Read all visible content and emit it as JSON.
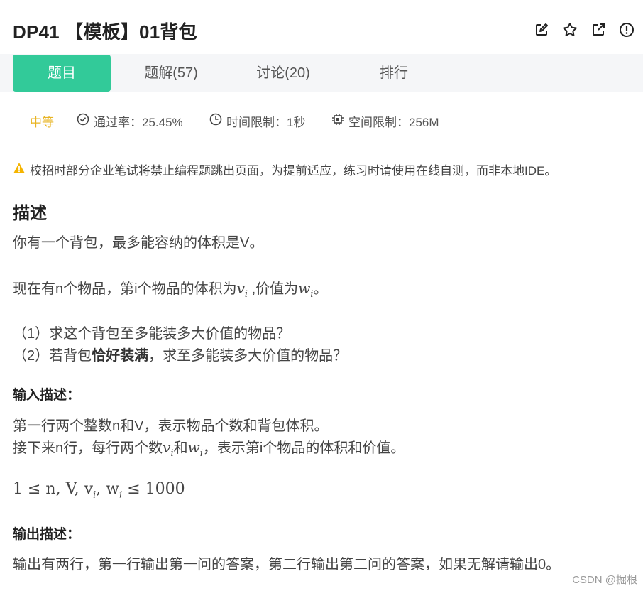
{
  "header": {
    "title": "DP41 【模板】01背包"
  },
  "tabs": [
    {
      "label": "题目"
    },
    {
      "label": "题解(57)"
    },
    {
      "label": "讨论(20)"
    },
    {
      "label": "排行"
    }
  ],
  "meta": {
    "difficulty": "中等",
    "pass_rate": "通过率：25.45%",
    "time_limit": "时间限制：1秒",
    "space_limit": "空间限制：256M"
  },
  "notice": "校招时部分企业笔试将禁止编程题跳出页面，为提前适应，练习时请使用在线自测，而非本地IDE。",
  "description": {
    "title": "描述",
    "line1": "你有一个背包，最多能容纳的体积是V。",
    "line2_prefix": "现在有n个物品，第i个物品的体积为",
    "line2_mid": " ,价值为",
    "line2_suffix": "。",
    "q1": "（1）求这个背包至多能装多大价值的物品？",
    "q2_prefix": "（2）若背包",
    "q2_bold": "恰好装满",
    "q2_suffix": "，求至多能装多大价值的物品？"
  },
  "input": {
    "title": "输入描述：",
    "line1": "第一行两个整数n和V，表示物品个数和背包体积。",
    "line2_prefix": "接下来n行，每行两个数",
    "line2_mid": "和",
    "line2_suffix": "，表示第i个物品的体积和价值。",
    "constraint": "1 ≤ n, V, v",
    "constraint_mid": ", w",
    "constraint_suffix": " ≤ 1000"
  },
  "math": {
    "v": "v",
    "w": "w",
    "sub_i": "i"
  },
  "output": {
    "title": "输出描述：",
    "line1": "输出有两行，第一行输出第一问的答案，第二行输出第二问的答案，如果无解请输出0。"
  },
  "watermark": "CSDN @掘根",
  "colors": {
    "accent": "#32ca99",
    "difficulty": "#e8b423",
    "warning": "#f5b400"
  }
}
